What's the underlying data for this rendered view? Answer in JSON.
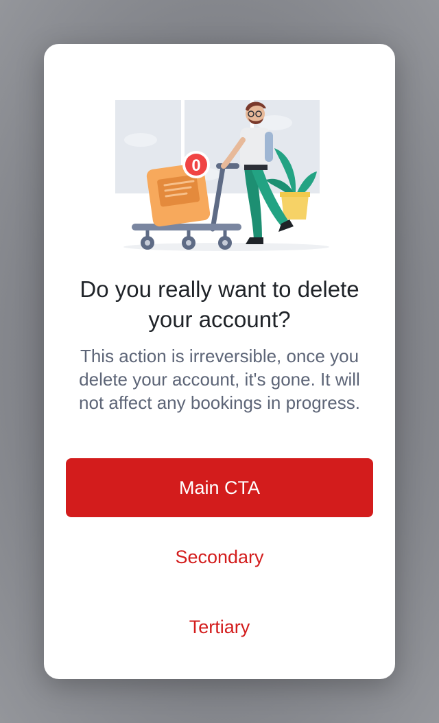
{
  "dialog": {
    "title": "Do you really want to delete your account?",
    "description": "This action is irreversible, once you delete your account, it's gone. It will not affect any bookings in progress.",
    "badge_count": "0",
    "illustration_icon": "traveler-with-luggage-cart-illustration"
  },
  "actions": {
    "main_label": "Main CTA",
    "secondary_label": "Secondary",
    "tertiary_label": "Tertiary"
  },
  "colors": {
    "accent": "#d31c1c",
    "title": "#1f2328",
    "body": "#5d6577",
    "backdrop": "#7d7f85"
  }
}
